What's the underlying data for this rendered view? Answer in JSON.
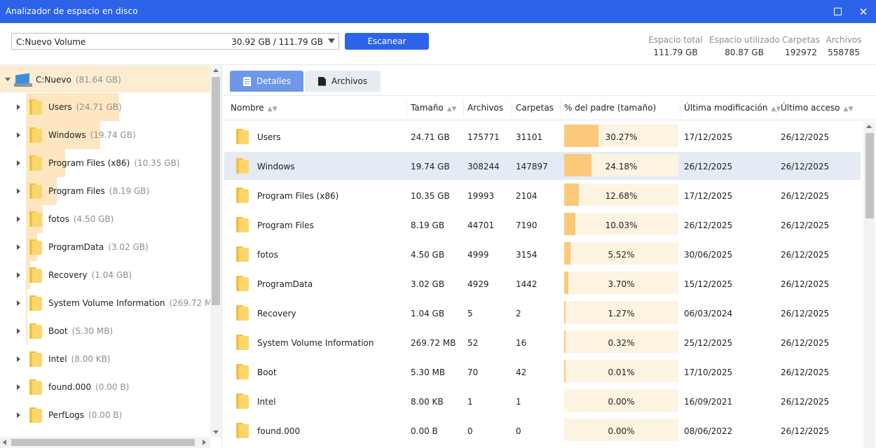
{
  "window": {
    "title": "Analizador de espacio en disco",
    "maximize_icon": "maximize-icon",
    "close_icon": "close-icon",
    "close_glyph": "✕"
  },
  "toolbar": {
    "drive_name": "C:Nuevo Volume",
    "drive_size": "30.92 GB / 111.79 GB",
    "scan_label": "Escanear",
    "stats": [
      {
        "label": "Espacio total",
        "value": "111.79 GB"
      },
      {
        "label": "Espacio utilizado",
        "value": "80.87 GB"
      },
      {
        "label": "Carpetas",
        "value": "192972"
      },
      {
        "label": "Archivos",
        "value": "558785"
      }
    ]
  },
  "tree": {
    "root": {
      "name": "C:Nuevo",
      "size": "(81.64 GB)"
    },
    "items": [
      {
        "name": "Users",
        "size": "(24.71 GB)",
        "fraction": 0.3027
      },
      {
        "name": "Windows",
        "size": "(19.74 GB)",
        "fraction": 0.2418
      },
      {
        "name": "Program Files (x86)",
        "size": "(10.35 GB)",
        "fraction": 0.1268
      },
      {
        "name": "Program Files",
        "size": "(8.19 GB)",
        "fraction": 0.1003
      },
      {
        "name": "fotos",
        "size": "(4.50 GB)",
        "fraction": 0.0552
      },
      {
        "name": "ProgramData",
        "size": "(3.02 GB)",
        "fraction": 0.037
      },
      {
        "name": "Recovery",
        "size": "(1.04 GB)",
        "fraction": 0.0127
      },
      {
        "name": "System Volume Information",
        "size": "(269.72 MB)",
        "fraction": 0.0032
      },
      {
        "name": "Boot",
        "size": "(5.30 MB)",
        "fraction": 0.0001
      },
      {
        "name": "Intel",
        "size": "(8.00 KB)",
        "fraction": 0
      },
      {
        "name": "found.000",
        "size": "(0.00 B)",
        "fraction": 0
      },
      {
        "name": "PerfLogs",
        "size": "(0.00 B)",
        "fraction": 0
      }
    ]
  },
  "tabs": {
    "details": "Detalles",
    "files": "Archivos"
  },
  "table": {
    "columns": {
      "name": "Nombre",
      "size": "Tamaño",
      "files": "Archivos",
      "folders": "Carpetas",
      "percent": "% del padre (tamaño)",
      "modified": "Última modificación",
      "accessed": "Último acceso"
    },
    "sort_glyph": "▲▼",
    "rows": [
      {
        "name": "Users",
        "size": "24.71 GB",
        "files": "175771",
        "folders": "31101",
        "percent": "30.27%",
        "fraction": 0.3027,
        "modified": "17/12/2025",
        "accessed": "26/12/2025"
      },
      {
        "name": "Windows",
        "size": "19.74 GB",
        "files": "308244",
        "folders": "147897",
        "percent": "24.18%",
        "fraction": 0.2418,
        "modified": "26/12/2025",
        "accessed": "26/12/2025",
        "selected": true
      },
      {
        "name": "Program Files (x86)",
        "size": "10.35 GB",
        "files": "19993",
        "folders": "2104",
        "percent": "12.68%",
        "fraction": 0.1268,
        "modified": "17/12/2025",
        "accessed": "26/12/2025"
      },
      {
        "name": "Program Files",
        "size": "8.19 GB",
        "files": "44701",
        "folders": "7190",
        "percent": "10.03%",
        "fraction": 0.1003,
        "modified": "26/12/2025",
        "accessed": "26/12/2025"
      },
      {
        "name": "fotos",
        "size": "4.50 GB",
        "files": "4999",
        "folders": "3154",
        "percent": "5.52%",
        "fraction": 0.0552,
        "modified": "30/06/2025",
        "accessed": "26/12/2025"
      },
      {
        "name": "ProgramData",
        "size": "3.02 GB",
        "files": "4929",
        "folders": "1442",
        "percent": "3.70%",
        "fraction": 0.037,
        "modified": "15/12/2025",
        "accessed": "26/12/2025"
      },
      {
        "name": "Recovery",
        "size": "1.04 GB",
        "files": "5",
        "folders": "2",
        "percent": "1.27%",
        "fraction": 0.0127,
        "modified": "06/03/2024",
        "accessed": "26/12/2025"
      },
      {
        "name": "System Volume Information",
        "size": "269.72 MB",
        "files": "52",
        "folders": "16",
        "percent": "0.32%",
        "fraction": 0.0032,
        "modified": "25/12/2025",
        "accessed": "26/12/2025"
      },
      {
        "name": "Boot",
        "size": "5.30 MB",
        "files": "70",
        "folders": "42",
        "percent": "0.01%",
        "fraction": 0.0001,
        "modified": "17/10/2025",
        "accessed": "26/12/2025"
      },
      {
        "name": "Intel",
        "size": "8.00 KB",
        "files": "1",
        "folders": "1",
        "percent": "0.00%",
        "fraction": 0,
        "modified": "16/09/2021",
        "accessed": "26/12/2025"
      },
      {
        "name": "found.000",
        "size": "0.00 B",
        "files": "0",
        "folders": "0",
        "percent": "0.00%",
        "fraction": 0,
        "modified": "08/06/2022",
        "accessed": "26/12/2025"
      }
    ]
  },
  "colors": {
    "accent": "#2d63e8",
    "tab_active": "#6e97e8",
    "bar_fill": "#fac97a",
    "bar_track": "#fdf3e1",
    "folder": "#fbd76b",
    "selected_row": "#e4ebf5"
  }
}
